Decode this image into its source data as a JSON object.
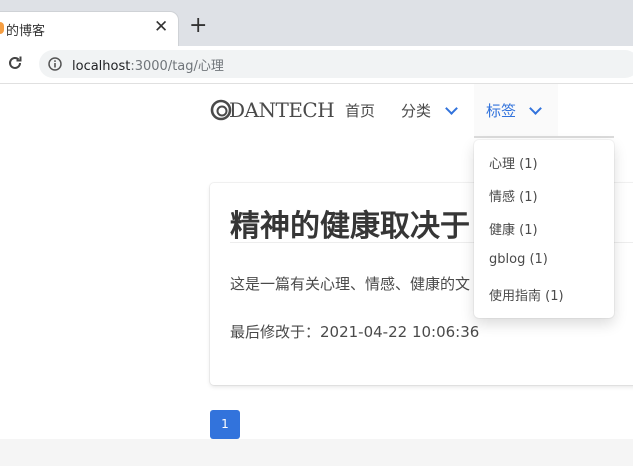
{
  "browser": {
    "tab_title": "的博客",
    "url_host": "localhost",
    "url_rest": ":3000/tag/心理"
  },
  "navbar": {
    "logo": "DANTECH",
    "items": [
      {
        "label": "首页"
      },
      {
        "label": "分类"
      },
      {
        "label": "标签"
      }
    ]
  },
  "dropdown": {
    "items": [
      {
        "label": "心理 (1)"
      },
      {
        "label": "情感 (1)"
      },
      {
        "label": "健康 (1)"
      },
      {
        "label": "gblog (1)"
      },
      {
        "label": "使用指南 (1)"
      }
    ]
  },
  "post": {
    "title": "精神的健康取决于",
    "description": "这是一篇有关心理、情感、健康的文",
    "modified": "最后修改于：2021-04-22 10:06:36"
  },
  "pagination": {
    "current": "1"
  },
  "colors": {
    "accent": "#3273dc",
    "text": "#4a4a4a"
  }
}
